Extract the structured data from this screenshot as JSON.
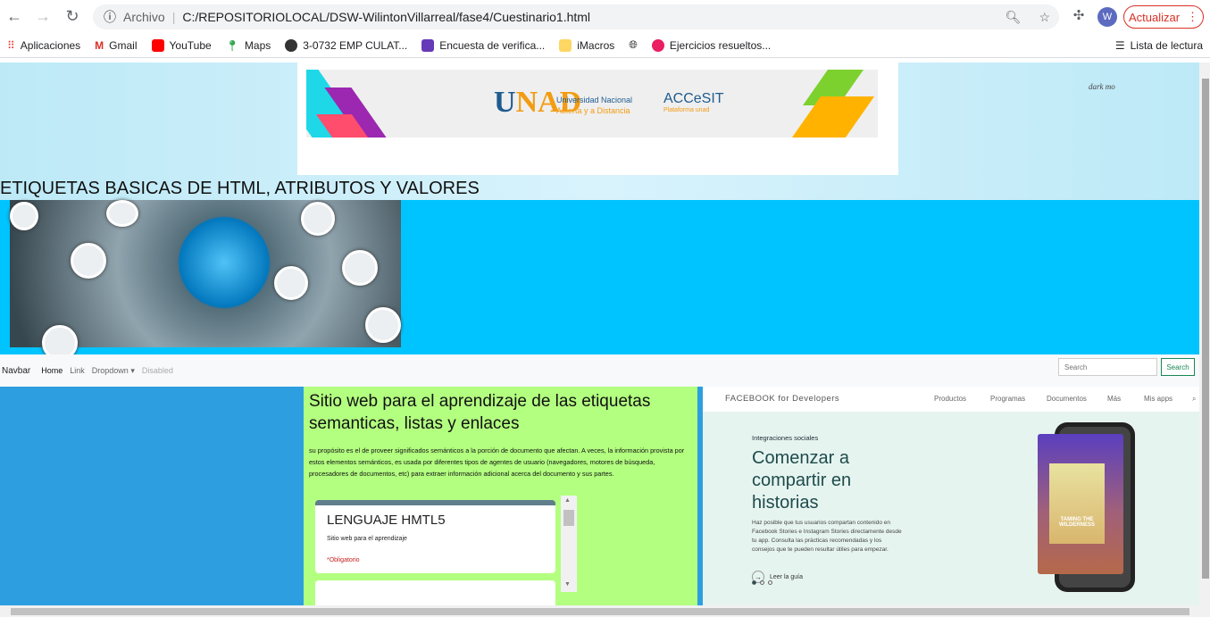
{
  "browser": {
    "url_label": "Archivo",
    "url": "C:/REPOSITORIOLOCAL/DSW-WilintonVillarreal/fase4/Cuestinario1.html",
    "update_label": "Actualizar",
    "avatar_initial": "W",
    "reading_list": "Lista de lectura",
    "bookmarks": [
      "Aplicaciones",
      "Gmail",
      "YouTube",
      "Maps",
      "3-0732 EMP CULAT...",
      "Encuesta de verifica...",
      "iMacros",
      "",
      "Ejercicios resueltos..."
    ]
  },
  "header": {
    "banner": {
      "logo": "UNAD",
      "logo_line1": "Universidad Nacional",
      "logo_line2": "Abierta y a Distancia",
      "accesit": "ACCeSIT",
      "accesit_sub": "Plataforma unad"
    },
    "dark_mode": "dark mo",
    "title": "ETIQUETAS BASICAS DE HTML, ATRIBUTOS Y VALORES"
  },
  "navbar": {
    "brand": "Navbar",
    "items": [
      "Home",
      "Link",
      "Dropdown",
      "Disabled"
    ],
    "search_placeholder": "Search",
    "search_button": "Search"
  },
  "middle": {
    "title": "Sitio web para el aprendizaje de las etiquetas semanticas, listas y enlaces",
    "paragraph": "su propósito es el de proveer significados semánticos a la porción de documento que afectan. A veces, la información provista por estos elementos semánticos, es usada por diferentes tipos de agentes de usuario (navegadores, motores de búsqueda, procesadores de documentos, etc) para extraer información adicional acerca del documento y sus partes.",
    "form": {
      "title": "LENGUAJE HMTL5",
      "subtitle": "Sitio web para el aprendizaje",
      "required": "*Obligatorio"
    }
  },
  "facebook": {
    "logo": "FACEBOOK for Developers",
    "nav": [
      "Productos",
      "Programas",
      "Documentos",
      "Más",
      "Mis apps"
    ],
    "kicker": "Integraciones sociales",
    "heading": "Comenzar a compartir en historias",
    "paragraph": "Haz posible que tus usuarios compartan contenido en Facebook Stories e Instagram Stories directamente desde tu app. Consulta las prácticas recomendadas y los consejos que te pueden resultar útiles para empezar.",
    "guide": "Leer la guía",
    "book": "TAMING THE WILDERNESS"
  },
  "colors": {
    "hero": "#00c4ff",
    "left": "#2d9fe0",
    "middle": "#b3ff80",
    "fb_bg": "#e6f4f0",
    "update": "#d93025"
  }
}
